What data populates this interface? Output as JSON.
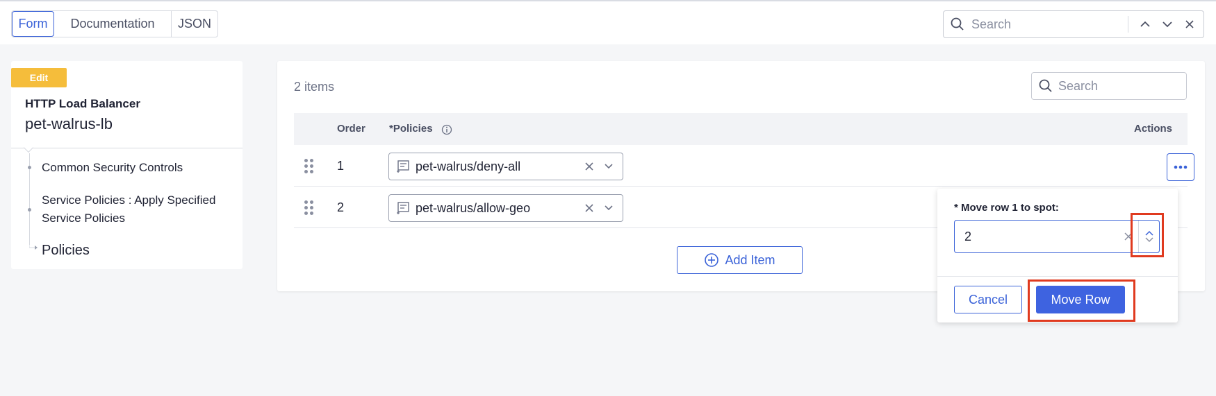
{
  "colors": {
    "accent": "#3a62d8",
    "badge": "#f5bd3b",
    "highlight": "#e03a1f",
    "primary_button": "#3e63e0"
  },
  "topbar": {
    "tabs": [
      {
        "label": "Form",
        "active": true
      },
      {
        "label": "Documentation"
      },
      {
        "label": "JSON"
      }
    ],
    "search": {
      "placeholder": "Search"
    }
  },
  "sidebar": {
    "badge": "Edit",
    "object_type": "HTTP Load Balancer",
    "object_name": "pet-walrus-lb",
    "tree": [
      {
        "label": "Common Security Controls"
      },
      {
        "label": "Service Policies : Apply Specified Service Policies"
      },
      {
        "label": "Policies",
        "current": true
      }
    ]
  },
  "table": {
    "count_label": "2 items",
    "search": {
      "placeholder": "Search"
    },
    "headers": {
      "order": "Order",
      "policies": "*Policies",
      "actions": "Actions"
    },
    "rows": [
      {
        "order": "1",
        "policy": "pet-walrus/deny-all"
      },
      {
        "order": "2",
        "policy": "pet-walrus/allow-geo"
      }
    ],
    "add_item_label": "Add Item"
  },
  "move_popover": {
    "label": "Move row 1 to spot:",
    "required_marker": "*",
    "value": "2",
    "cancel_label": "Cancel",
    "move_label": "Move Row"
  }
}
